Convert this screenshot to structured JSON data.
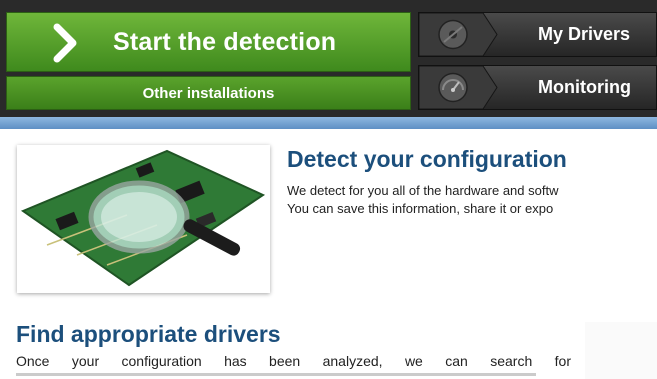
{
  "nav": {
    "start_label": "Start the detection",
    "other_label": "Other installations",
    "drivers_label": "My Drivers",
    "monitoring_label": "Monitoring"
  },
  "icons": {
    "start": "chevron-right-icon",
    "drivers": "disc-icon",
    "monitoring": "gauge-icon"
  },
  "colors": {
    "green": "#4f9d27",
    "dark": "#2a2a2a",
    "blue_strip": "#6f9fd0",
    "heading": "#1c4f7c"
  },
  "detect": {
    "title": "Detect your configuration",
    "line1": "We detect for you all of the hardware and softw",
    "line2": "You can save this information, share it or expo"
  },
  "find": {
    "title": "Find appropriate drivers",
    "line1": "Once your configuration has been analyzed, we can search for"
  }
}
